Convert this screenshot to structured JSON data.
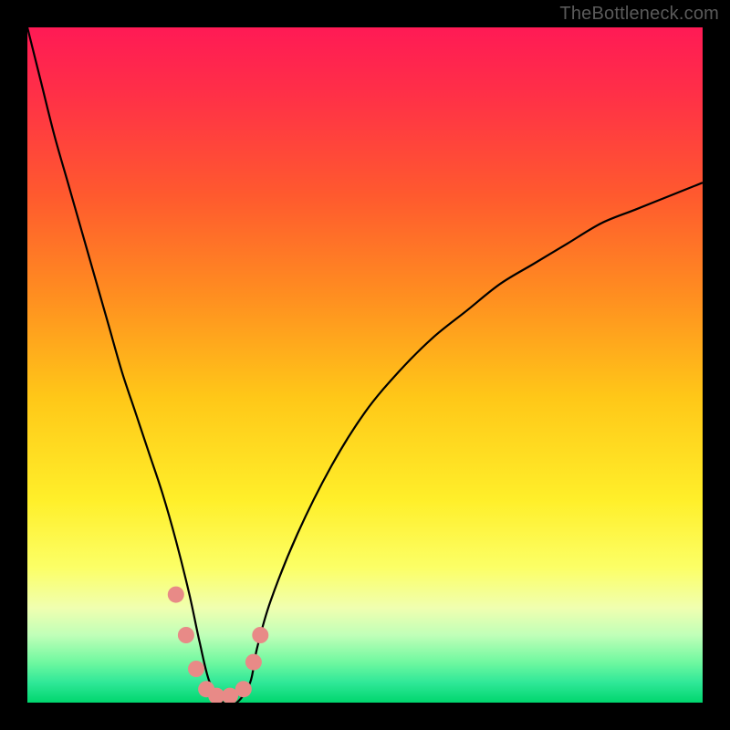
{
  "watermark": "TheBottleneck.com",
  "chart_data": {
    "type": "line",
    "title": "",
    "xlabel": "",
    "ylabel": "",
    "xlim": [
      0,
      100
    ],
    "ylim": [
      0,
      100
    ],
    "background_gradient": {
      "stops": [
        {
          "pos": 0.0,
          "color": "#ff1a55"
        },
        {
          "pos": 0.1,
          "color": "#ff3047"
        },
        {
          "pos": 0.25,
          "color": "#ff5a2e"
        },
        {
          "pos": 0.4,
          "color": "#ff8f20"
        },
        {
          "pos": 0.55,
          "color": "#ffc818"
        },
        {
          "pos": 0.7,
          "color": "#ffef2a"
        },
        {
          "pos": 0.8,
          "color": "#fcff66"
        },
        {
          "pos": 0.86,
          "color": "#f0ffb0"
        },
        {
          "pos": 0.9,
          "color": "#c0ffb8"
        },
        {
          "pos": 0.94,
          "color": "#70f8a0"
        },
        {
          "pos": 0.97,
          "color": "#30e898"
        },
        {
          "pos": 1.0,
          "color": "#00d66e"
        }
      ]
    },
    "series": [
      {
        "name": "bottleneck-curve",
        "x": [
          0,
          2,
          4,
          6,
          8,
          10,
          12,
          14,
          16,
          18,
          20,
          22,
          24,
          25.5,
          27,
          29,
          31,
          33,
          34,
          36,
          40,
          45,
          50,
          55,
          60,
          65,
          70,
          75,
          80,
          85,
          90,
          95,
          100
        ],
        "y": [
          100,
          92,
          84,
          77,
          70,
          63,
          56,
          49,
          43,
          37,
          31,
          24,
          16,
          9,
          3,
          0,
          0,
          3,
          8,
          15,
          25,
          35,
          43,
          49,
          54,
          58,
          62,
          65,
          68,
          71,
          73,
          75,
          77
        ]
      }
    ],
    "markers": [
      {
        "x": 22.0,
        "y": 16
      },
      {
        "x": 23.5,
        "y": 10
      },
      {
        "x": 25.0,
        "y": 5
      },
      {
        "x": 26.5,
        "y": 2
      },
      {
        "x": 28.0,
        "y": 1
      },
      {
        "x": 30.0,
        "y": 1
      },
      {
        "x": 32.0,
        "y": 2
      },
      {
        "x": 33.5,
        "y": 6
      },
      {
        "x": 34.5,
        "y": 10
      }
    ],
    "marker_color": "#e88a87",
    "curve_color": "#000000"
  }
}
